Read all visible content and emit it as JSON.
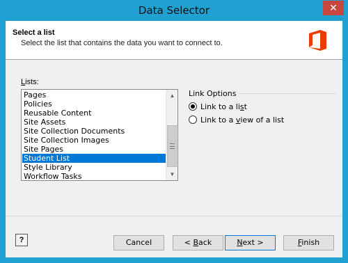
{
  "window": {
    "title": "Data Selector",
    "close_glyph": "✕"
  },
  "header": {
    "title": "Select a list",
    "subtitle": "Select the list that contains the data you want to connect to.",
    "logo_icon": "office-logo-icon",
    "logo_color": "#eb3c00"
  },
  "lists": {
    "label_access": "L",
    "label_rest": "ists:",
    "items": [
      "Pages",
      "Policies",
      "Reusable Content",
      "Site Assets",
      "Site Collection Documents",
      "Site Collection Images",
      "Site Pages",
      "Student List",
      "Style Library",
      "Workflow Tasks"
    ],
    "selected": "Student List",
    "selected_color": "#0078d7"
  },
  "link_options": {
    "title": "Link Options",
    "option1": {
      "pre": "Link to a li",
      "access": "s",
      "post": "t",
      "checked": true
    },
    "option2": {
      "pre": "Link to a ",
      "access": "v",
      "post": "iew of a list",
      "checked": false
    }
  },
  "buttons": {
    "help": "?",
    "cancel": "Cancel",
    "back_pre": "< ",
    "back_access": "B",
    "back_post": "ack",
    "next_access": "N",
    "next_post": "ext >",
    "finish_access": "F",
    "finish_post": "inish"
  }
}
